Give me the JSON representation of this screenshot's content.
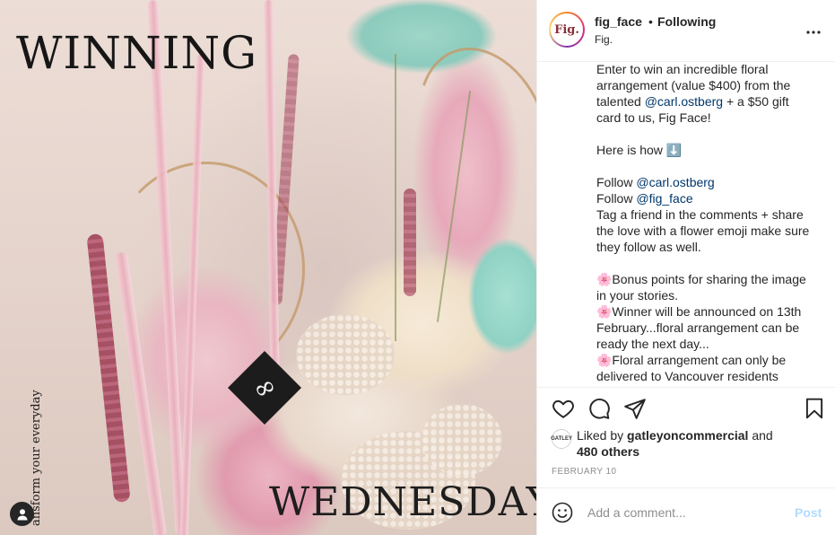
{
  "post_image": {
    "headline_top": "WINNING",
    "headline_bottom": "WEDNESDAY",
    "tagline": "ansform your everyday",
    "logo_glyph": "∞"
  },
  "header": {
    "username": "fig_face",
    "separator": "•",
    "follow_status": "Following",
    "location": "Fig.",
    "avatar_text": "Fig.",
    "more_icon": "more-horizontal-icon"
  },
  "caption": {
    "intro_1": "Enter to win an incredible floral",
    "intro_2": "arrangement (value $400) from the",
    "intro_3a": "talented ",
    "intro_mention": "@carl.ostberg",
    "intro_3b": " + a $50 gift",
    "intro_4": "card to us, Fig Face!",
    "how": "Here is how ⬇️",
    "follow_word": "Follow ",
    "follow_1": "@carl.ostberg",
    "follow_2": "@fig_face",
    "tag_1": "Tag a friend in the comments + share",
    "tag_2": "the love with a flower emoji make sure",
    "tag_3": "they follow as well.",
    "bonus_1": "🌸Bonus points for sharing the image",
    "bonus_2": "in your stories.",
    "winner_1": "🌸Winner will be announced on 13th",
    "winner_2": "February...floral arrangement can be",
    "winner_3": "ready the next day...",
    "floral_1": "🌸Floral arrangement can only be",
    "floral_2": "delivered to Vancouver residents"
  },
  "actions": {
    "like_icon": "heart-icon",
    "comment_icon": "comment-icon",
    "share_icon": "paper-plane-icon",
    "save_icon": "bookmark-icon"
  },
  "likes": {
    "prefix": "Liked by ",
    "user": "gatleyoncommercial",
    "and": " and",
    "others": "480 others",
    "avatar_text": "GATLEY"
  },
  "date": "FEBRUARY 10",
  "comment": {
    "placeholder": "Add a comment...",
    "post_label": "Post"
  },
  "colors": {
    "mention": "#00376b",
    "post_disabled": "#b3dbff",
    "muted": "#8e8e8e"
  }
}
